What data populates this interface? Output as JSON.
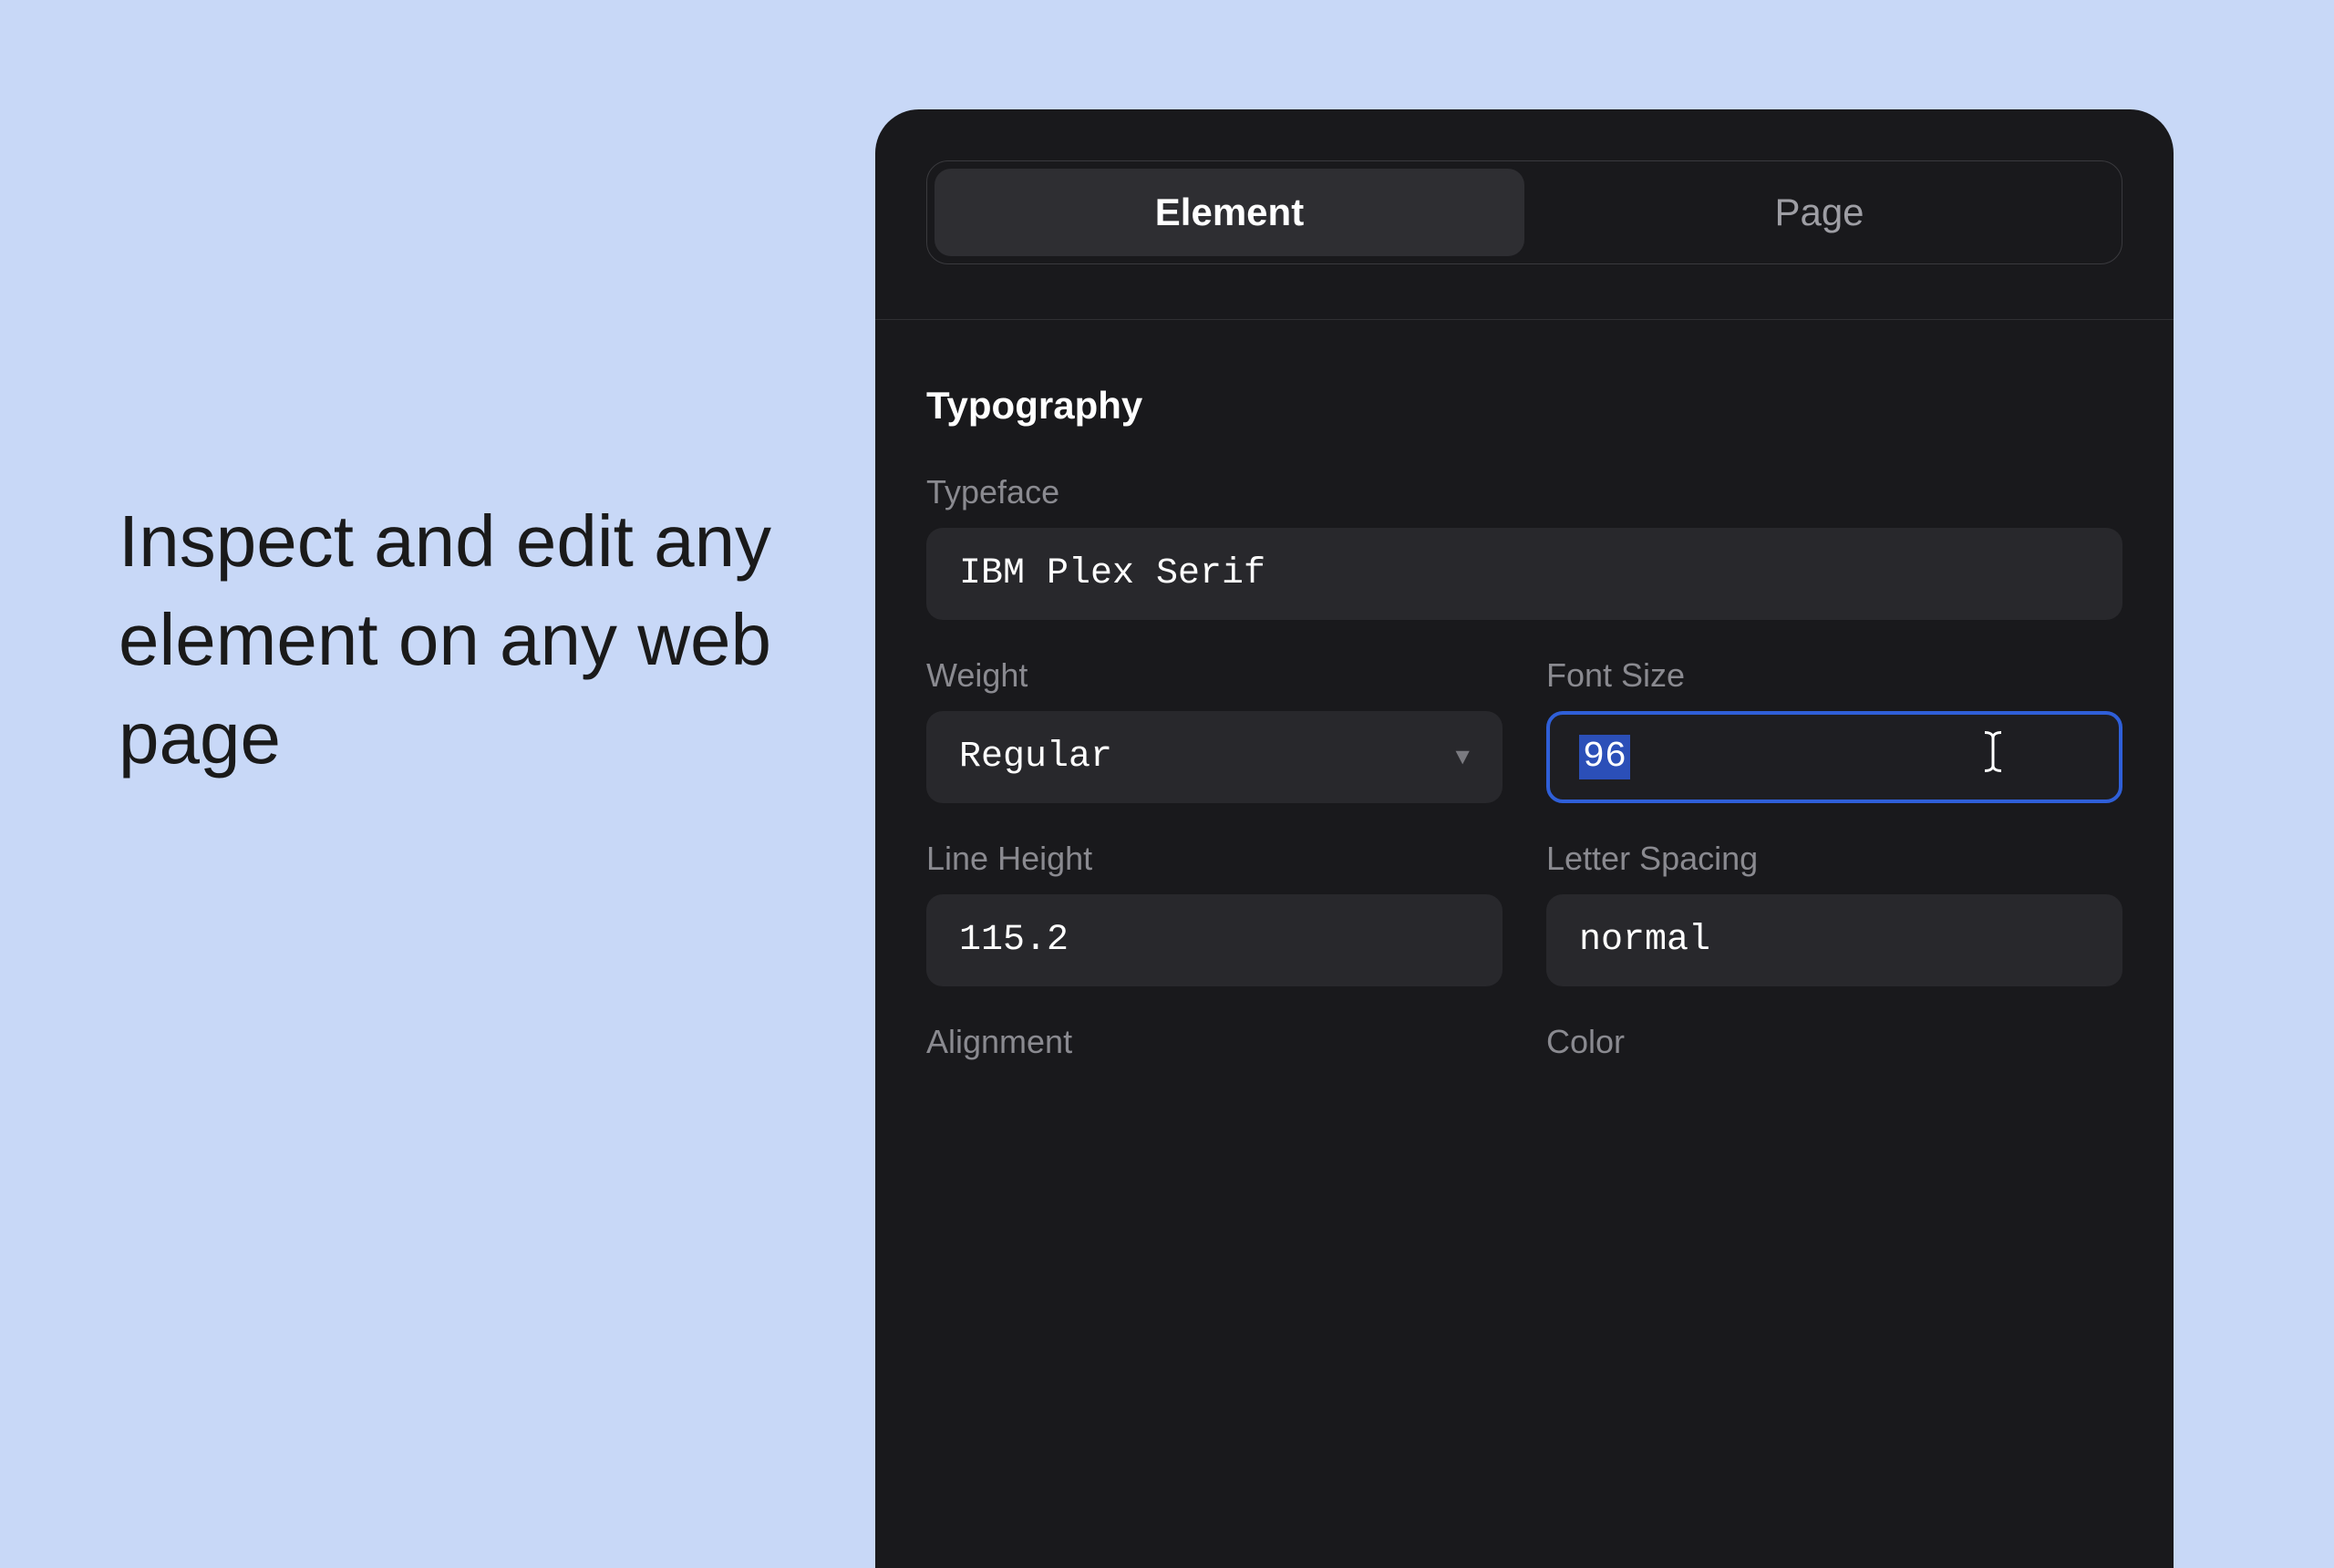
{
  "promo": {
    "text": "Inspect and edit any element on any web page"
  },
  "tabs": {
    "element": "Element",
    "page": "Page"
  },
  "typography": {
    "section_title": "Typography",
    "typeface": {
      "label": "Typeface",
      "value": "IBM Plex Serif"
    },
    "weight": {
      "label": "Weight",
      "value": "Regular"
    },
    "font_size": {
      "label": "Font Size",
      "value": "96"
    },
    "line_height": {
      "label": "Line Height",
      "value": "115.2"
    },
    "letter_spacing": {
      "label": "Letter Spacing",
      "value": "normal"
    },
    "alignment": {
      "label": "Alignment"
    },
    "color": {
      "label": "Color"
    }
  }
}
